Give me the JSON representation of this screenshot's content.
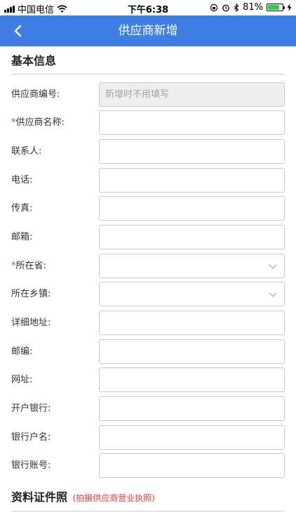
{
  "status_bar": {
    "carrier": "中国电信",
    "time": "下午6:38",
    "battery_percent_text": "81%",
    "battery_level": 0.81
  },
  "nav": {
    "title": "供应商新增",
    "back_icon": "chevron-left-icon",
    "accent_color": "#3e7fe6"
  },
  "sections": {
    "basic_info": "基本信息",
    "documents": "资料证件照",
    "documents_hint": "(拍摄供应商营业执照)"
  },
  "form": {
    "required_mark": "*",
    "supplier_code": {
      "label": "供应商编号:",
      "placeholder": "新增时不用填写",
      "value": ""
    },
    "supplier_name": {
      "label": "供应商名称:",
      "value": ""
    },
    "contact": {
      "label": "联系人:",
      "value": ""
    },
    "phone": {
      "label": "电话:",
      "value": ""
    },
    "fax": {
      "label": "传真:",
      "value": ""
    },
    "email": {
      "label": "邮箱:",
      "value": ""
    },
    "province": {
      "label": "所在省:",
      "value": ""
    },
    "township": {
      "label": "所在乡镇:",
      "value": ""
    },
    "address": {
      "label": "详细地址:",
      "value": ""
    },
    "postcode": {
      "label": "邮编:",
      "value": ""
    },
    "website": {
      "label": "网址:",
      "value": ""
    },
    "bank": {
      "label": "开户银行:",
      "value": ""
    },
    "account_name": {
      "label": "银行户名:",
      "value": ""
    },
    "account_number": {
      "label": "银行账号:",
      "value": ""
    }
  }
}
